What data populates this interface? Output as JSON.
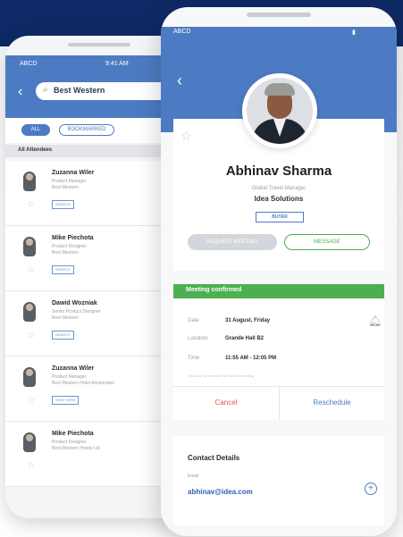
{
  "back_screen": {
    "status_left": "ABCD",
    "status_time": "9:41 AM",
    "search_value": "Best Western",
    "chips": [
      "ALL",
      "BOOKMARKED"
    ],
    "section_title": "All Attendees",
    "attendees": [
      {
        "name": "Zuzanna Wiler",
        "role": "Product Manager",
        "company": "Best Western",
        "tag": "SEARCH"
      },
      {
        "name": "Mike Piechota",
        "role": "Product Designer",
        "company": "Best Western",
        "tag": "SEARCH"
      },
      {
        "name": "Dawid Wozniak",
        "role": "Senior Product Designer",
        "company": "Best Western",
        "tag": "SEARCH"
      },
      {
        "name": "Zuzanna Wiler",
        "role": "Product Manager",
        "company": "Best Western Hotel Amsterdam",
        "tag": "TAKE HERE"
      },
      {
        "name": "Mike Piechota",
        "role": "Product Designer",
        "company": "Best Western Hotels Ltd",
        "tag": ""
      }
    ]
  },
  "front_screen": {
    "status_left": "ABCD",
    "profile": {
      "name": "Abhinav Sharma",
      "role": "Global Travel Manager",
      "company": "Idea Solutions",
      "badge": "BUYER"
    },
    "actions": {
      "request": "REQUEST MEETING",
      "message": "MESSAGE"
    },
    "meeting": {
      "status": "Meeting confirmed",
      "rows": [
        {
          "label": "Date",
          "value": "31 August, Friday"
        },
        {
          "label": "Location",
          "value": "Grande Hall B2"
        },
        {
          "label": "Time",
          "value": "11:55 AM - 12:05 PM"
        }
      ],
      "note": "You have no reminder set for this meeting",
      "cancel": "Cancel",
      "reschedule": "Reschedule"
    },
    "contact": {
      "title": "Contact Details",
      "email_label": "Email",
      "email_value": "abhinav@idea.com"
    }
  }
}
